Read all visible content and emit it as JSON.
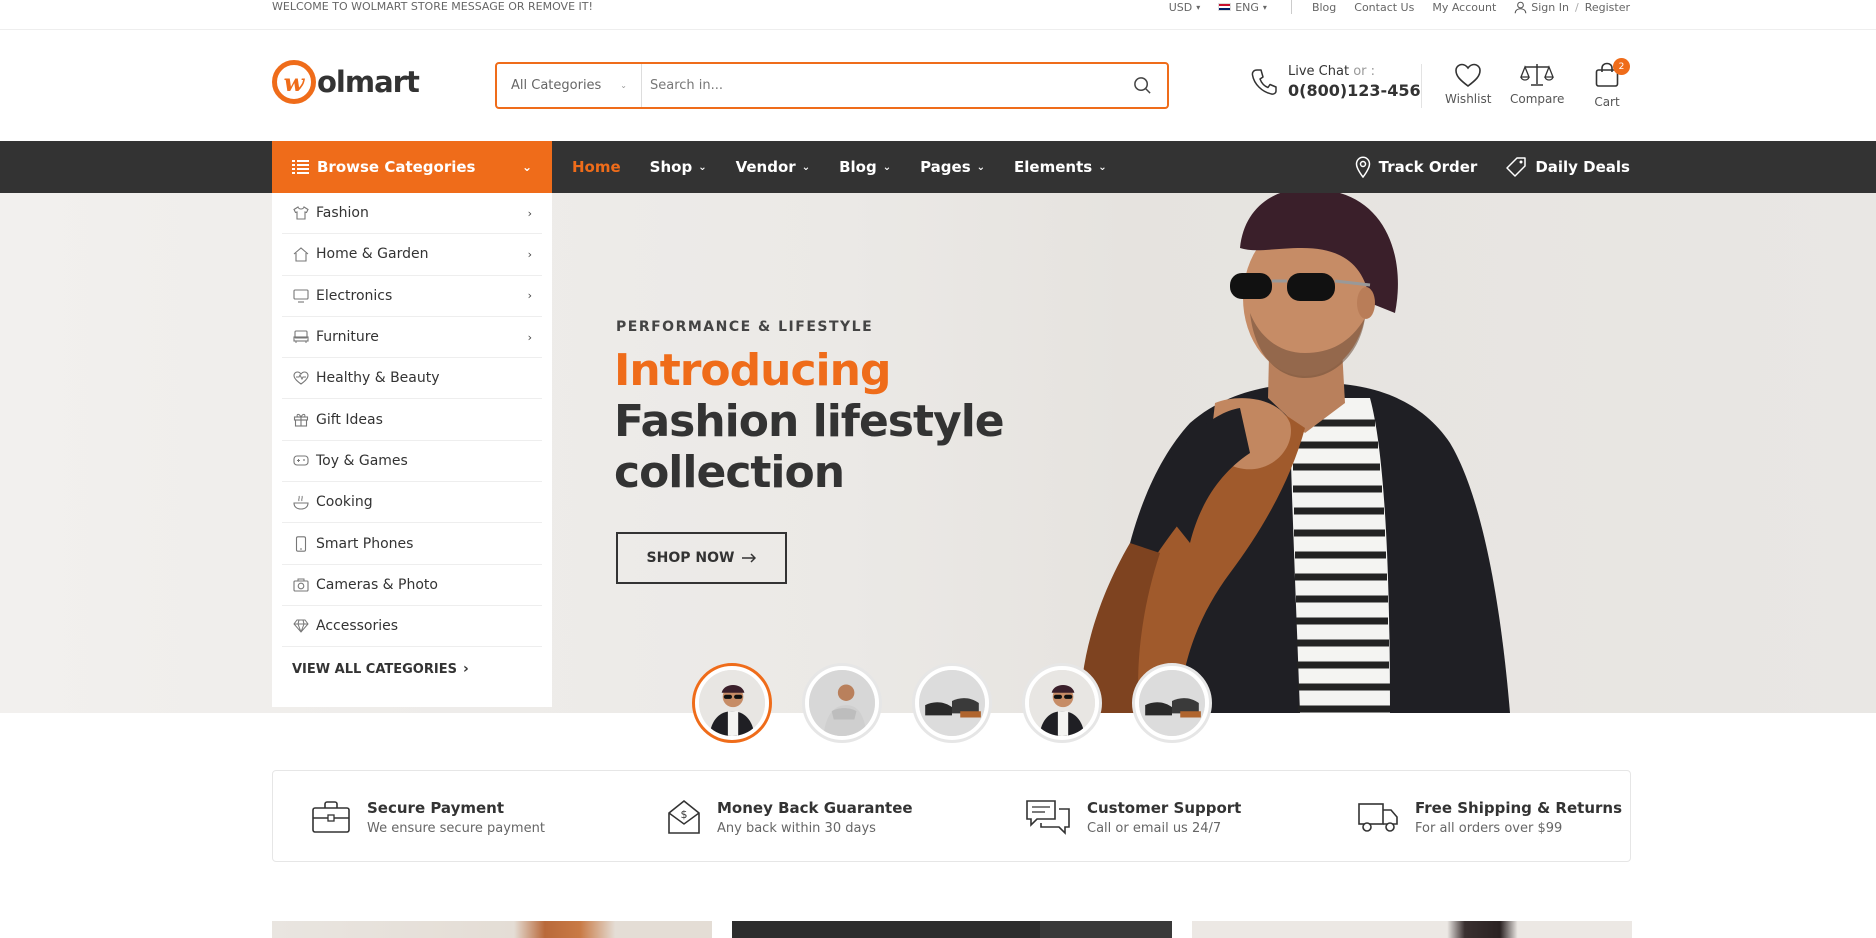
{
  "topbar": {
    "welcome": "WELCOME TO WOLMART STORE MESSAGE OR REMOVE IT!",
    "currency": "USD",
    "language": "ENG",
    "links": [
      "Blog",
      "Contact Us",
      "My Account"
    ],
    "sign_in": "Sign In",
    "register": "Register"
  },
  "header": {
    "logo_letter": "w",
    "logo_text": "olmart",
    "search": {
      "category": "All Categories",
      "placeholder": "Search in..."
    },
    "live_chat": "Live Chat",
    "or": "or :",
    "phone": "0(800)123-456",
    "wishlist": "Wishlist",
    "compare": "Compare",
    "cart": "Cart",
    "cart_count": "2"
  },
  "nav": {
    "browse": "Browse Categories",
    "items": [
      "Home",
      "Shop",
      "Vendor",
      "Blog",
      "Pages",
      "Elements"
    ],
    "track_order": "Track Order",
    "daily_deals": "Daily Deals"
  },
  "categories": {
    "items": [
      {
        "label": "Fashion",
        "icon": "tshirt-icon",
        "has_sub": true
      },
      {
        "label": "Home & Garden",
        "icon": "home-icon",
        "has_sub": true
      },
      {
        "label": "Electronics",
        "icon": "monitor-icon",
        "has_sub": true
      },
      {
        "label": "Furniture",
        "icon": "sofa-icon",
        "has_sub": true
      },
      {
        "label": "Healthy & Beauty",
        "icon": "heart-pulse-icon",
        "has_sub": false
      },
      {
        "label": "Gift Ideas",
        "icon": "gift-icon",
        "has_sub": false
      },
      {
        "label": "Toy & Games",
        "icon": "gamepad-icon",
        "has_sub": false
      },
      {
        "label": "Cooking",
        "icon": "cooking-icon",
        "has_sub": false
      },
      {
        "label": "Smart Phones",
        "icon": "phone-icon",
        "has_sub": false
      },
      {
        "label": "Cameras & Photo",
        "icon": "camera-icon",
        "has_sub": false
      },
      {
        "label": "Accessories",
        "icon": "diamond-icon",
        "has_sub": false
      }
    ],
    "view_all": "VIEW ALL CATEGORIES"
  },
  "hero": {
    "subtitle": "PERFORMANCE & LIFESTYLE",
    "title_orange": "Introducing",
    "title_dark": "Fashion lifestyle collection",
    "button": "SHOP NOW"
  },
  "features": [
    {
      "title": "Secure Payment",
      "sub": "We ensure secure payment",
      "icon": "briefcase-icon"
    },
    {
      "title": "Money Back Guarantee",
      "sub": "Any back within 30 days",
      "icon": "money-envelope-icon"
    },
    {
      "title": "Customer Support",
      "sub": "Call or email us 24/7",
      "icon": "chat-icon"
    },
    {
      "title": "Free Shipping & Returns",
      "sub": "For all orders over $99",
      "icon": "truck-icon"
    }
  ],
  "colors": {
    "accent": "#ef6c1a",
    "nav_bg": "#333333"
  }
}
